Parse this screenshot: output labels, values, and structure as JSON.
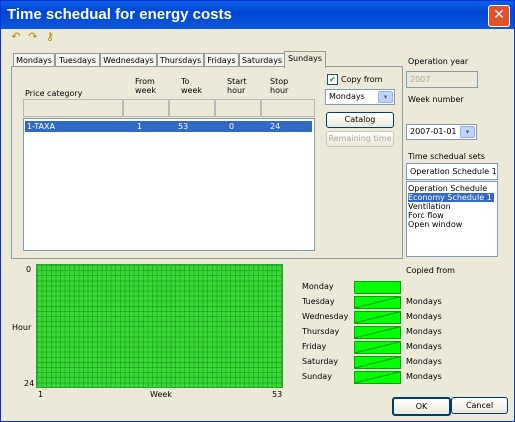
{
  "window": {
    "title": "Time schedual for energy costs",
    "close_glyph": "✕"
  },
  "toolbar": {
    "icons": [
      "undo-icon",
      "redo-icon",
      "key-icon"
    ],
    "glyphs": [
      "↶",
      "↷",
      "⚷"
    ]
  },
  "tabs": [
    "Mondays",
    "Tuesdays",
    "Wednesdays",
    "Thursdays",
    "Fridays",
    "Saturdays",
    "Sundays"
  ],
  "active_tab": "Sundays",
  "table": {
    "headers": {
      "price_category": "Price category",
      "from_week": "From\nweek",
      "to_week": "To\nweek",
      "start_hour": "Start\nhour",
      "stop_hour": "Stop\nhour"
    },
    "rows": [
      {
        "price_category": "1-TAXA",
        "from_week": "1",
        "to_week": "53",
        "start_hour": "0",
        "stop_hour": "24"
      }
    ]
  },
  "copy_from": {
    "label": "Copy from",
    "checked": true,
    "value": "Mondays",
    "arrow": "▾"
  },
  "buttons": {
    "catalog": "Catalog",
    "remaining_time": "Remaining time",
    "ok": "OK",
    "cancel": "Cancel"
  },
  "operation_year": {
    "label": "Operation year",
    "value": "2007"
  },
  "week_number": {
    "label": "Week number",
    "value": "2007-01-01"
  },
  "time_sets": {
    "label": "Time schedual sets",
    "current": "Operation Schedule 1",
    "items": [
      "Operation Schedule 1",
      "Economy Schedule 1",
      "Ventilation",
      "Forc flow",
      "Open window"
    ],
    "selected": "Economy Schedule 1"
  },
  "chart": {
    "y_top": "0",
    "y_bottom": "24",
    "y_label": "Hour",
    "x_left": "1",
    "x_label": "Week",
    "x_right": "53",
    "fill_color": "#3ad63a"
  },
  "days": {
    "copied_from_label": "Copied from",
    "rows": [
      {
        "day": "Monday",
        "copied_from": ""
      },
      {
        "day": "Tuesday",
        "copied_from": "Mondays"
      },
      {
        "day": "Wednesday",
        "copied_from": "Mondays"
      },
      {
        "day": "Thursday",
        "copied_from": "Mondays"
      },
      {
        "day": "Friday",
        "copied_from": "Mondays"
      },
      {
        "day": "Saturday",
        "copied_from": "Mondays"
      },
      {
        "day": "Sunday",
        "copied_from": "Mondays"
      }
    ]
  }
}
